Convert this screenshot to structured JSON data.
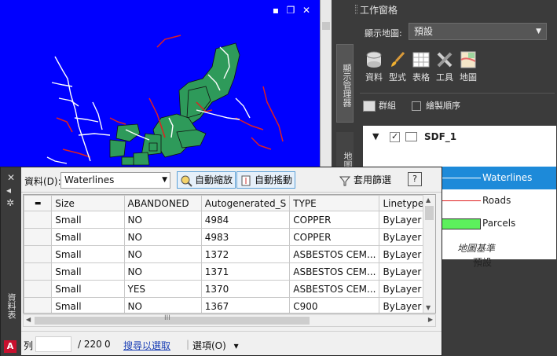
{
  "window_controls": {
    "minimize": "▪",
    "restore": "❐",
    "close": "✕"
  },
  "taskpane": {
    "title": "工作窗格",
    "vertical_tabs": [
      "顯示管理器",
      "地圖總管"
    ],
    "map_label": "顯示地圖:",
    "map_value": "預設",
    "tools": [
      {
        "label": "資料",
        "icon": "database-icon"
      },
      {
        "label": "型式",
        "icon": "brush-icon"
      },
      {
        "label": "表格",
        "icon": "table-icon"
      },
      {
        "label": "工具",
        "icon": "tools-icon"
      },
      {
        "label": "地圖",
        "icon": "map-icon"
      }
    ],
    "group_label": "群組",
    "draw_order_label": "繪製順序",
    "layers": {
      "group_name": "SDF_1",
      "items": [
        {
          "name": "Waterlines",
          "selected": true,
          "color": "#ffffff"
        },
        {
          "name": "Roads",
          "selected": false,
          "color": "#e02020"
        },
        {
          "name": "Parcels",
          "selected": false,
          "color": "#5cf05c"
        }
      ],
      "base_label": "地圖基準",
      "base_value": "預設"
    }
  },
  "datatable": {
    "side_label": "資料表",
    "logo": "A",
    "toolbar": {
      "data_label": "資料(D):",
      "source": "Waterlines",
      "auto_zoom": "自動縮放",
      "auto_pan": "自動搖動",
      "apply_filter": "套用篩選",
      "help": "?"
    },
    "columns": [
      "Size",
      "ABANDONED",
      "Autogenerated_S",
      "TYPE",
      "Linetype"
    ],
    "rows": [
      [
        "Small",
        "NO",
        "4984",
        "COPPER",
        "ByLayer"
      ],
      [
        "Small",
        "NO",
        "4983",
        "COPPER",
        "ByLayer"
      ],
      [
        "Small",
        "NO",
        "1372",
        "ASBESTOS CEM...",
        "ByLayer"
      ],
      [
        "Small",
        "NO",
        "1371",
        "ASBESTOS CEM...",
        "ByLayer"
      ],
      [
        "Small",
        "YES",
        "1370",
        "ASBESTOS CEM...",
        "ByLayer"
      ],
      [
        "Small",
        "NO",
        "1367",
        "C900",
        "ByLayer"
      ]
    ],
    "hscroll_thumb": "III",
    "status": {
      "row_label": "列",
      "total": "/ 220",
      "count": "0",
      "search_link": "搜尋以選取",
      "options": "選項(O)",
      "options_arrow": "▾"
    }
  },
  "colors": {
    "map_bg": "#0000ff",
    "parcels": "#2e9a5a",
    "roads": "#e02020",
    "waterlines": "#ffffff",
    "accent": "#1d8ad9"
  }
}
